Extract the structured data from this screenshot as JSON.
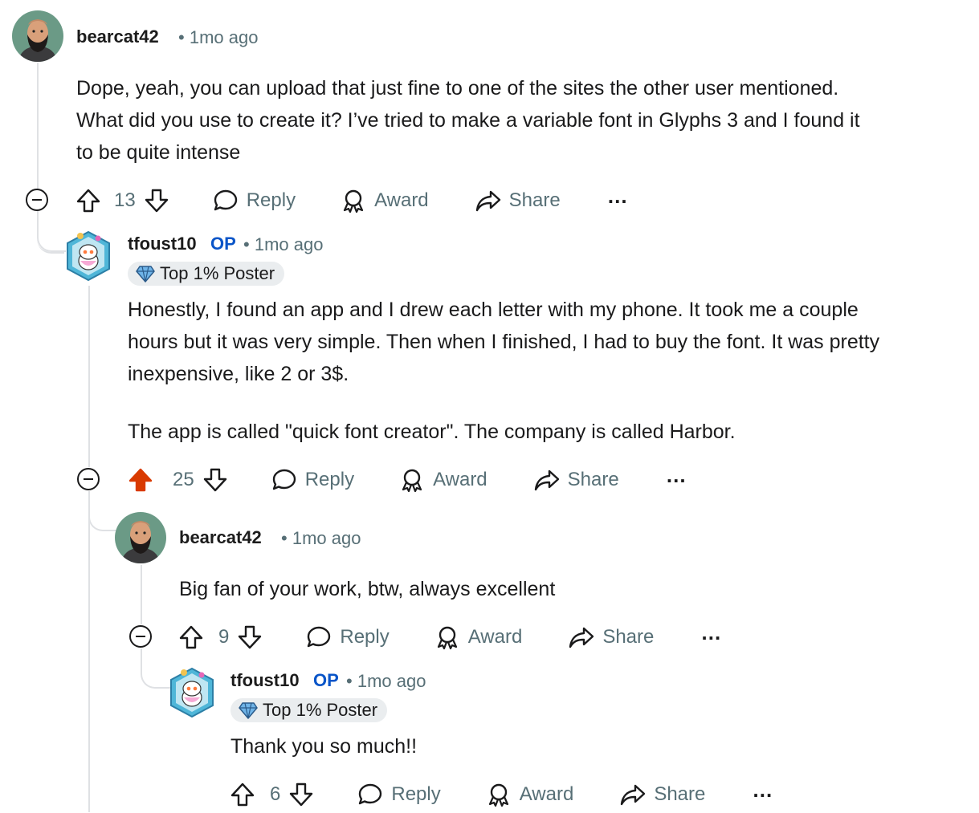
{
  "comments": [
    {
      "username": "bearcat42",
      "timestamp": "1mo ago",
      "body_lines": [
        "Dope, yeah, you can upload that just fine to one of the sites the other user mentioned.",
        "What did you use to create it? I’ve tried to make a variable font in Glyphs 3 and I found it",
        "to be quite intense"
      ],
      "score": "13",
      "upvoted": false
    },
    {
      "username": "tfoust10",
      "op_label": "OP",
      "timestamp": "1mo ago",
      "flair": "Top 1% Poster",
      "body_lines": [
        "Honestly, I found an app and I drew each letter with my phone. It took me a couple",
        "hours but it was very simple. Then when I finished, I had to buy the font. It was pretty",
        "inexpensive, like 2 or 3$."
      ],
      "body_paragraph2": "The app is called \"quick font creator\". The company is called Harbor.",
      "score": "25",
      "upvoted": true
    },
    {
      "username": "bearcat42",
      "timestamp": "1mo ago",
      "body": "Big fan of your work, btw, always excellent",
      "score": "9",
      "upvoted": false
    },
    {
      "username": "tfoust10",
      "op_label": "OP",
      "timestamp": "1mo ago",
      "flair": "Top 1% Poster",
      "body": "Thank you so much!!",
      "score": "6",
      "upvoted": false
    }
  ],
  "actions": {
    "reply": "Reply",
    "award": "Award",
    "share": "Share",
    "more": "…"
  },
  "meta_separator": "•",
  "colors": {
    "upvote_active": "#d93a00",
    "op": "#0a55c8",
    "muted": "#576f76",
    "thread_line": "#dfe1e4",
    "flair_bg": "#eaedef"
  },
  "icons": [
    "upvote-icon",
    "downvote-icon",
    "reply-icon",
    "award-icon",
    "share-icon",
    "more-icon",
    "collapse-icon",
    "avatar-bearded-man",
    "avatar-snoo",
    "flair-diamond-icon"
  ]
}
